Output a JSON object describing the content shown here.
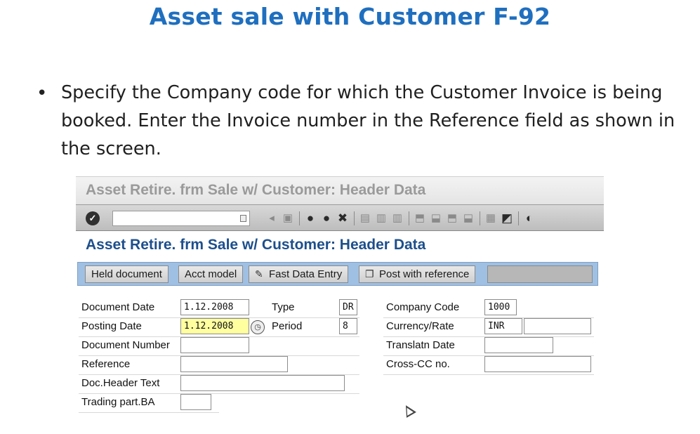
{
  "slide": {
    "title": "Asset sale with Customer  F-92",
    "bullet": "Specify the Company code for which the Customer Invoice is being booked. Enter the Invoice number in the Reference field as shown in the screen."
  },
  "sap": {
    "window_title": "Asset Retire. frm Sale w/ Customer: Header Data",
    "screen_title": "Asset Retire. frm Sale w/ Customer: Header Data",
    "command_field": {
      "value": ""
    },
    "toolbar_icons": [
      "enter-icon",
      "back-icon",
      "save-icon",
      "exit-icon",
      "cancel-icon",
      "print-icon",
      "find-icon",
      "find-next-icon",
      "first-page-icon",
      "prev-page-icon",
      "next-page-icon",
      "last-page-icon",
      "new-session-icon",
      "shortcut-icon",
      "help-icon"
    ],
    "app_buttons": {
      "held_document": "Held document",
      "acct_model": "Acct model",
      "fast_data_entry": "Fast Data Entry",
      "post_with_reference": "Post with reference"
    },
    "fields": {
      "document_date": {
        "label": "Document Date",
        "value": "1.12.2008"
      },
      "posting_date": {
        "label": "Posting Date",
        "value": "1.12.2008"
      },
      "document_number": {
        "label": "Document Number",
        "value": ""
      },
      "reference": {
        "label": "Reference",
        "value": ""
      },
      "doc_header_text": {
        "label": "Doc.Header Text",
        "value": ""
      },
      "trading_part_ba": {
        "label": "Trading part.BA",
        "value": ""
      },
      "type": {
        "label": "Type",
        "value": "DR"
      },
      "period": {
        "label": "Period",
        "value": "8"
      },
      "company_code": {
        "label": "Company Code",
        "value": "1000"
      },
      "currency_rate": {
        "label": "Currency/Rate",
        "currency": "INR",
        "rate": ""
      },
      "translatn_date": {
        "label": "Translatn Date",
        "value": ""
      },
      "cross_cc_no": {
        "label": "Cross-CC no.",
        "value": ""
      }
    },
    "colors": {
      "title_blue": "#1f6fbf",
      "screen_title": "#1d4f8c",
      "app_toolbar": "#9fc0e3",
      "required_field": "#ffffa0"
    }
  }
}
